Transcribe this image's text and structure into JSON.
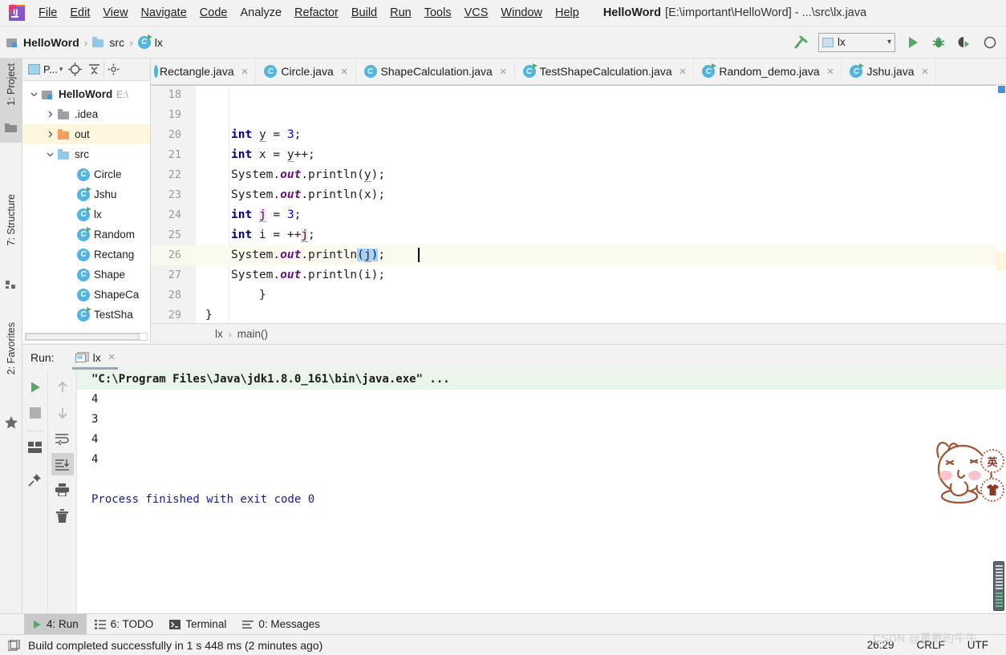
{
  "app": {
    "logo_icon": "intellij-idea-logo",
    "window_title_project": "HelloWord",
    "window_title_path": "[E:\\important\\HelloWord] - ...\\src\\lx.java"
  },
  "menubar": {
    "items": [
      {
        "label": "File",
        "mnemonic": "F"
      },
      {
        "label": "Edit",
        "mnemonic": "E"
      },
      {
        "label": "View",
        "mnemonic": "V"
      },
      {
        "label": "Navigate",
        "mnemonic": "N"
      },
      {
        "label": "Code",
        "mnemonic": "C"
      },
      {
        "label": "Analyze",
        "mnemonic": "z"
      },
      {
        "label": "Refactor",
        "mnemonic": "R"
      },
      {
        "label": "Build",
        "mnemonic": "B"
      },
      {
        "label": "Run",
        "mnemonic": "u"
      },
      {
        "label": "Tools",
        "mnemonic": "T"
      },
      {
        "label": "VCS",
        "mnemonic": "S"
      },
      {
        "label": "Window",
        "mnemonic": "W"
      },
      {
        "label": "Help",
        "mnemonic": "H"
      }
    ]
  },
  "navbar": {
    "breadcrumbs": [
      {
        "label": "HelloWord",
        "icon": "module-icon",
        "bold": true
      },
      {
        "label": "src",
        "icon": "folder-source-icon",
        "bold": false
      },
      {
        "label": "lx",
        "icon": "java-class-runnable-icon",
        "bold": false
      }
    ],
    "separator": "›",
    "run_config": {
      "label": "lx",
      "icon": "run-config-icon",
      "arrow": "⌄"
    },
    "buttons": [
      {
        "name": "build-hammer-icon",
        "label": ""
      },
      {
        "name": "run-button",
        "label": ""
      },
      {
        "name": "debug-button",
        "label": ""
      },
      {
        "name": "run-with-coverage-button",
        "label": ""
      },
      {
        "name": "attach-profiler-button",
        "label": ""
      }
    ]
  },
  "tool_strips": {
    "left": [
      {
        "label": "1: Project",
        "mnemonic": "1",
        "active": true,
        "icon": "project-folder-icon"
      },
      {
        "label": "7: Structure",
        "mnemonic": "7",
        "active": false,
        "icon": "structure-icon"
      },
      {
        "label": "2: Favorites",
        "mnemonic": "2",
        "active": false,
        "icon": "star-icon"
      }
    ]
  },
  "project_panel": {
    "toolbar": [
      {
        "name": "project-view-selector",
        "label": "P...",
        "icon": "project-view-icon"
      },
      {
        "name": "scroll-from-source-button",
        "label": "",
        "icon": "target-icon"
      },
      {
        "name": "collapse-all-button",
        "label": "",
        "icon": "collapse-all-icon"
      },
      {
        "name": "settings-button",
        "label": "",
        "icon": "gear-icon"
      }
    ],
    "tree": [
      {
        "label": "HelloWord",
        "indent": 0,
        "twisty": "down",
        "icon": "module-icon",
        "bold": true,
        "path": "E:\\",
        "highlighted": false
      },
      {
        "label": ".idea",
        "indent": 1,
        "twisty": "right",
        "icon": "folder-gray-icon",
        "bold": false,
        "path": "",
        "highlighted": false
      },
      {
        "label": "out",
        "indent": 1,
        "twisty": "right",
        "icon": "folder-orange-icon",
        "bold": false,
        "path": "",
        "highlighted": true
      },
      {
        "label": "src",
        "indent": 1,
        "twisty": "down",
        "icon": "folder-source-icon",
        "bold": false,
        "path": "",
        "highlighted": false
      },
      {
        "label": "Circle",
        "indent": 2,
        "twisty": "",
        "icon": "java-class-icon",
        "bold": false,
        "path": "",
        "highlighted": false
      },
      {
        "label": "Jshu",
        "indent": 2,
        "twisty": "",
        "icon": "java-class-runnable-icon",
        "bold": false,
        "path": "",
        "highlighted": false
      },
      {
        "label": "lx",
        "indent": 2,
        "twisty": "",
        "icon": "java-class-runnable-icon",
        "bold": false,
        "path": "",
        "highlighted": false
      },
      {
        "label": "Random",
        "indent": 2,
        "twisty": "",
        "icon": "java-class-runnable-icon",
        "bold": false,
        "path": "",
        "highlighted": false
      },
      {
        "label": "Rectang",
        "indent": 2,
        "twisty": "",
        "icon": "java-class-icon",
        "bold": false,
        "path": "",
        "highlighted": false
      },
      {
        "label": "Shape",
        "indent": 2,
        "twisty": "",
        "icon": "java-class-icon",
        "bold": false,
        "path": "",
        "highlighted": false
      },
      {
        "label": "ShapeCa",
        "indent": 2,
        "twisty": "",
        "icon": "java-class-icon",
        "bold": false,
        "path": "",
        "highlighted": false
      },
      {
        "label": "TestSha",
        "indent": 2,
        "twisty": "",
        "icon": "java-class-runnable-icon",
        "bold": false,
        "path": "",
        "highlighted": false
      }
    ]
  },
  "editor": {
    "tabs": [
      {
        "label": "Rectangle.java",
        "icon": "java-class-icon",
        "active": false,
        "icon_clipped": true,
        "close": "×"
      },
      {
        "label": "Circle.java",
        "icon": "java-class-icon",
        "active": false,
        "icon_clipped": false,
        "close": "×"
      },
      {
        "label": "ShapeCalculation.java",
        "icon": "java-class-icon",
        "active": false,
        "icon_clipped": false,
        "close": "×"
      },
      {
        "label": "TestShapeCalculation.java",
        "icon": "java-class-runnable-icon",
        "active": false,
        "icon_clipped": false,
        "close": "×"
      },
      {
        "label": "Random_demo.java",
        "icon": "java-class-runnable-icon",
        "active": false,
        "icon_clipped": false,
        "close": "×"
      },
      {
        "label": "Jshu.java",
        "icon": "java-class-runnable-icon",
        "active": false,
        "icon_clipped": false,
        "close": "×"
      }
    ],
    "first_visible_line": 18,
    "current_line": 26,
    "lines": [
      {
        "number": "18",
        "text": ""
      },
      {
        "number": "19",
        "text": ""
      },
      {
        "number": "20",
        "text": "        int y = 3;"
      },
      {
        "number": "21",
        "text": "        int x = y++;"
      },
      {
        "number": "22",
        "text": "        System.out.println(y);"
      },
      {
        "number": "23",
        "text": "        System.out.println(x);"
      },
      {
        "number": "24",
        "text": "        int j = 3;"
      },
      {
        "number": "25",
        "text": "        int i = ++j;"
      },
      {
        "number": "26",
        "text": "        System.out.println(j);"
      },
      {
        "number": "27",
        "text": "        System.out.println(i);"
      },
      {
        "number": "28",
        "text": "    }"
      },
      {
        "number": "29",
        "text": "}"
      }
    ],
    "breadcrumb": {
      "class": "lx",
      "method": "main()",
      "separator": "›"
    }
  },
  "run_window": {
    "title": "Run:",
    "tab": {
      "label": "lx",
      "icon": "run-config-icon",
      "close": "×"
    },
    "toolbar_primary": [
      {
        "name": "rerun-button",
        "icon": "play-green-icon"
      },
      {
        "name": "stop-button",
        "icon": "stop-square-icon"
      },
      {
        "name": "layout-settings-button",
        "icon": "layout-icon"
      },
      {
        "name": "pin-tab-button",
        "icon": "pin-icon"
      }
    ],
    "toolbar_secondary": [
      {
        "name": "up-stacktrace-button",
        "icon": "arrow-up-icon"
      },
      {
        "name": "down-stacktrace-button",
        "icon": "arrow-down-icon"
      },
      {
        "name": "soft-wrap-button",
        "icon": "soft-wrap-icon"
      },
      {
        "name": "scroll-to-end-button",
        "icon": "scroll-to-end-icon",
        "selected": true
      },
      {
        "name": "print-button",
        "icon": "printer-icon"
      },
      {
        "name": "clear-all-button",
        "icon": "trash-icon"
      }
    ],
    "console": [
      {
        "text": "\"C:\\Program Files\\Java\\jdk1.8.0_161\\bin\\java.exe\" ...",
        "kind": "command"
      },
      {
        "text": "4",
        "kind": "output"
      },
      {
        "text": "3",
        "kind": "output"
      },
      {
        "text": "4",
        "kind": "output"
      },
      {
        "text": "4",
        "kind": "output"
      },
      {
        "text": "",
        "kind": "output"
      },
      {
        "text": "Process finished with exit code 0",
        "kind": "system"
      }
    ]
  },
  "bottom_bar": {
    "buttons": [
      {
        "label": "4: Run",
        "mnemonic": "4",
        "icon": "play-green-icon",
        "active": true
      },
      {
        "label": "6: TODO",
        "mnemonic": "6",
        "icon": "todo-list-icon",
        "active": false
      },
      {
        "label": "Terminal",
        "mnemonic": "",
        "icon": "terminal-icon",
        "active": false
      },
      {
        "label": "0: Messages",
        "mnemonic": "0",
        "icon": "messages-icon",
        "active": false
      }
    ]
  },
  "status_bar": {
    "icon": "event-log-icon",
    "message": "Build completed successfully in 1 s 448 ms (2 minutes ago)",
    "caret_position": "26:29",
    "line_separator": "CRLF",
    "encoding": "UTF"
  },
  "overlays": {
    "watermark": "CSDN @勇敢的牛牛",
    "ime": {
      "mode_badge": "英",
      "skin_badge": "࿐",
      "mascot": "rabbit-mascot"
    }
  },
  "colors": {
    "accent_blue": "#4a90d9",
    "green": "#59a869",
    "class_icon": "#52b4e0",
    "current_line": "#fcfaee",
    "highlight_row": "#fdf6dd",
    "console_cmd_bg": "#eaf5ea",
    "console_text": "#1a1a8c"
  }
}
